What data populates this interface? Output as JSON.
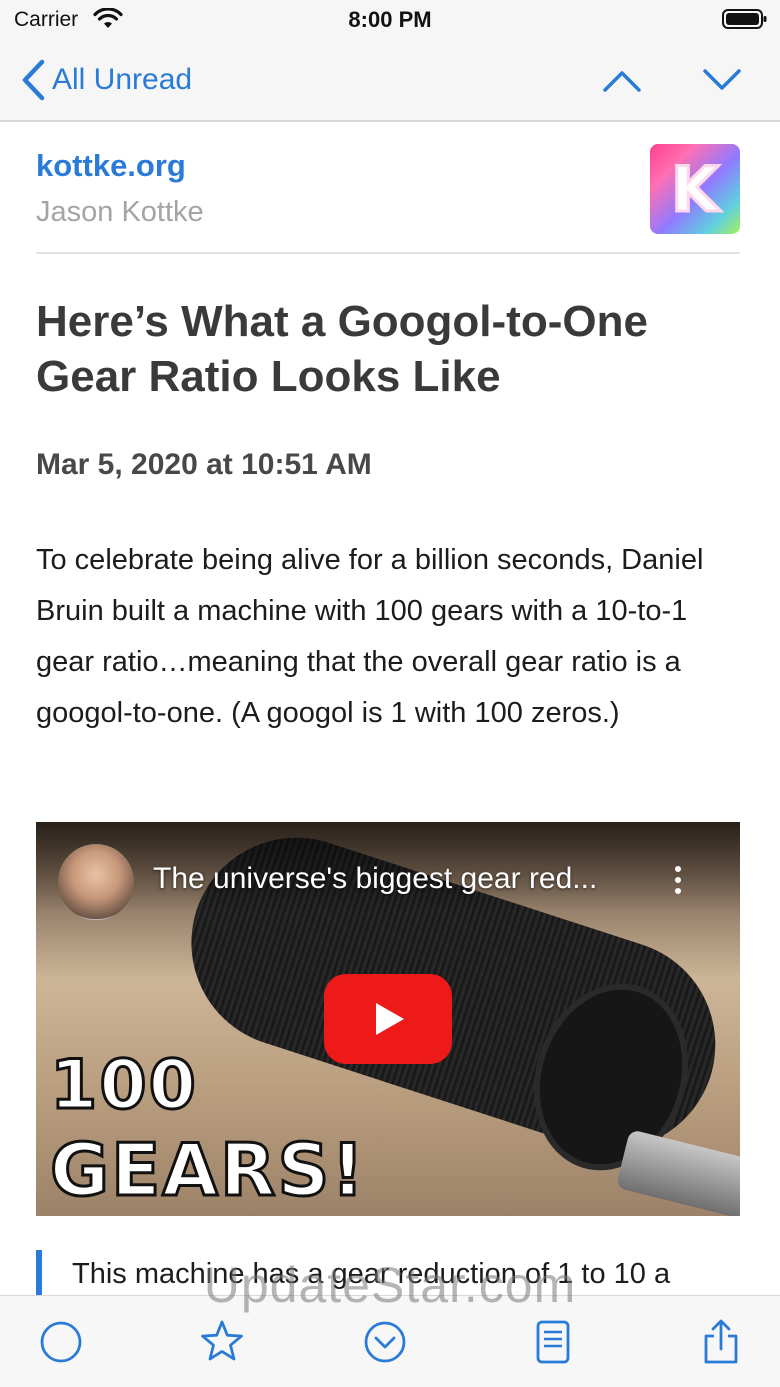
{
  "status_bar": {
    "carrier": "Carrier",
    "time": "8:00 PM"
  },
  "nav": {
    "back_label": "All Unread"
  },
  "feed": {
    "name": "kottke.org",
    "author": "Jason Kottke",
    "logo_letter": "K"
  },
  "article": {
    "title": "Here’s What a Googol-to-One Gear Ratio Looks Like",
    "date": "Mar 5, 2020 at 10:51 AM",
    "body": "To celebrate being alive for a billion seconds, Daniel Bruin built a machine with 100 gears with a 10-to-1 gear ratio…meaning that the overall gear ratio is a googol-to-one. (A googol is 1 with 100 zeros.)",
    "video": {
      "title": "The universe's biggest gear red...",
      "thumb_line1": "100",
      "thumb_line2": "GEARS!"
    },
    "quote": "This machine has a gear reduction of 1 to 10 a"
  },
  "watermark": "UpdateStar.com",
  "colors": {
    "accent": "#2a7bd8",
    "play_red": "#ee1a1a"
  },
  "icons": {
    "toolbar": [
      "circle-icon",
      "star-icon",
      "chevron-circle-icon",
      "reader-icon",
      "share-icon"
    ]
  }
}
